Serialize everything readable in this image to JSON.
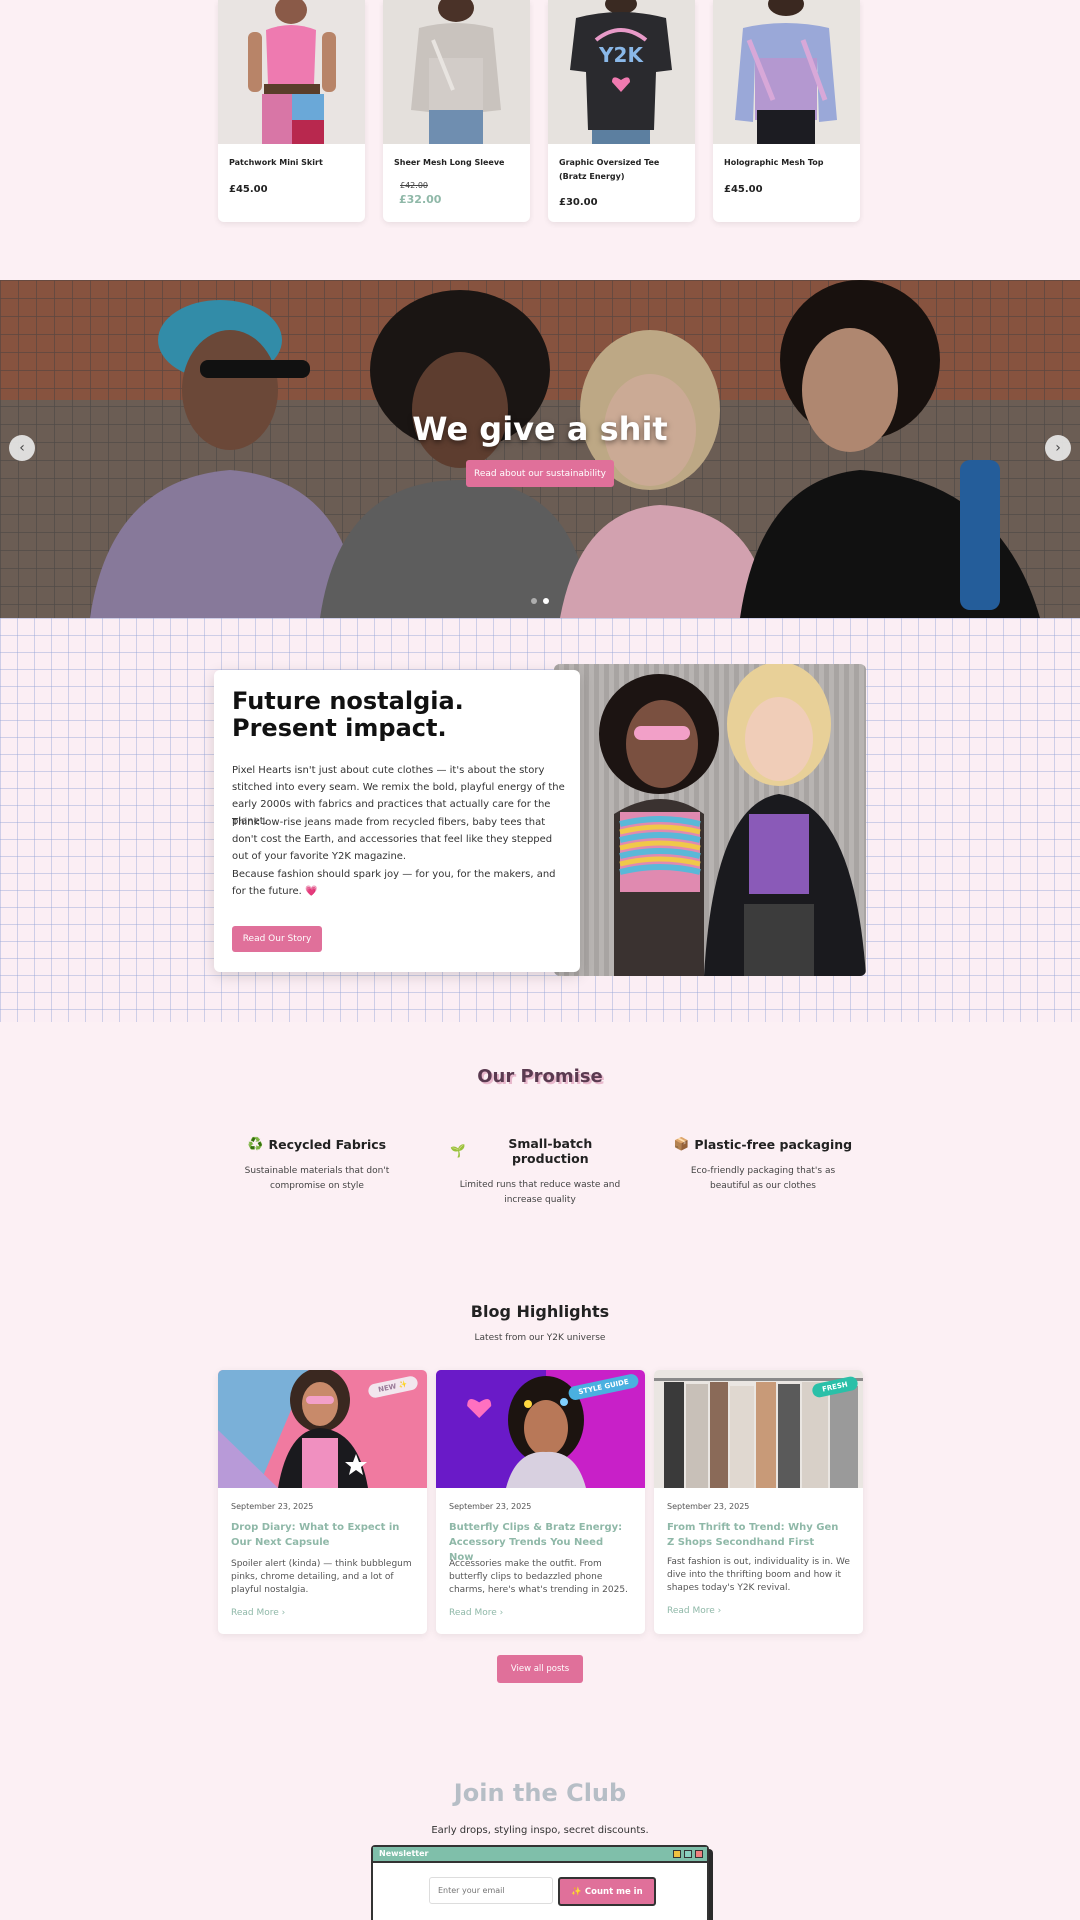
{
  "products": [
    {
      "name": "Patchwork Mini Skirt",
      "price": "£45.00"
    },
    {
      "name": "Sheer Mesh Long Sleeve",
      "old_price": "£42.00",
      "price": "£32.00"
    },
    {
      "name": "Graphic Oversized Tee (Bratz Energy)",
      "price": "£30.00"
    },
    {
      "name": "Holographic Mesh Top",
      "price": "£45.00"
    }
  ],
  "hero": {
    "title": "We give a shit",
    "button": "Read about our sustainability",
    "prev_icon": "chevron-left-icon",
    "next_icon": "chevron-right-icon",
    "active_slide": 2,
    "total_slides": 2
  },
  "story": {
    "title": "Future nostalgia. Present impact.",
    "p1": "Pixel Hearts isn't just about cute clothes — it's about the story stitched into every seam. We remix the bold, playful energy of the early 2000s with fabrics and practices that actually care for the planet.",
    "p2": "Think low-rise jeans made from recycled fibers, baby tees that don't cost the Earth, and accessories that feel like they stepped out of your favorite Y2K magazine.",
    "p3": "Because fashion should spark joy — for you, for the makers, and for the future. 💗",
    "button": "Read Our Story"
  },
  "promise": {
    "title": "Our Promise",
    "items": [
      {
        "icon": "♻️",
        "title": "Recycled Fabrics",
        "desc": "Sustainable materials that don't compromise on style"
      },
      {
        "icon": "🌱",
        "title": "Small-batch production",
        "desc": "Limited runs that reduce waste and increase quality"
      },
      {
        "icon": "📦",
        "title": "Plastic-free packaging",
        "desc": "Eco-friendly packaging that's as beautiful as our clothes"
      }
    ]
  },
  "blog": {
    "title": "Blog Highlights",
    "subtitle": "Latest from our Y2K universe",
    "posts": [
      {
        "tag": "NEW ✨",
        "date": "September 23, 2025",
        "title": "Drop Diary: What to Expect in Our Next Capsule",
        "excerpt": "Spoiler alert (kinda) — think bubblegum pinks, chrome detailing, and a lot of playful nostalgia.",
        "more": "Read More"
      },
      {
        "tag": "STYLE GUIDE",
        "date": "September 23, 2025",
        "title": "Butterfly Clips & Bratz Energy: Accessory Trends You Need Now",
        "excerpt": "Accessories make the outfit. From butterfly clips to bedazzled phone charms, here's what's trending in 2025.",
        "more": "Read More"
      },
      {
        "tag": "FRESH",
        "date": "September 23, 2025",
        "title": "From Thrift to Trend: Why Gen Z Shops Secondhand First",
        "excerpt": "Fast fashion is out, individuality is in. We dive into the thrifting boom and how it shapes today's Y2K revival.",
        "more": "Read More"
      }
    ],
    "all_button": "View all posts"
  },
  "newsletter": {
    "title": "Join the Club",
    "subtitle": "Early drops, styling inspo, secret discounts.",
    "window_title": "Newsletter",
    "placeholder": "Enter your email",
    "button": "✨ Count me in"
  },
  "colors": {
    "accent_pink": "#e0709a",
    "mint": "#8fb8a8",
    "background": "#fcf0f4"
  }
}
